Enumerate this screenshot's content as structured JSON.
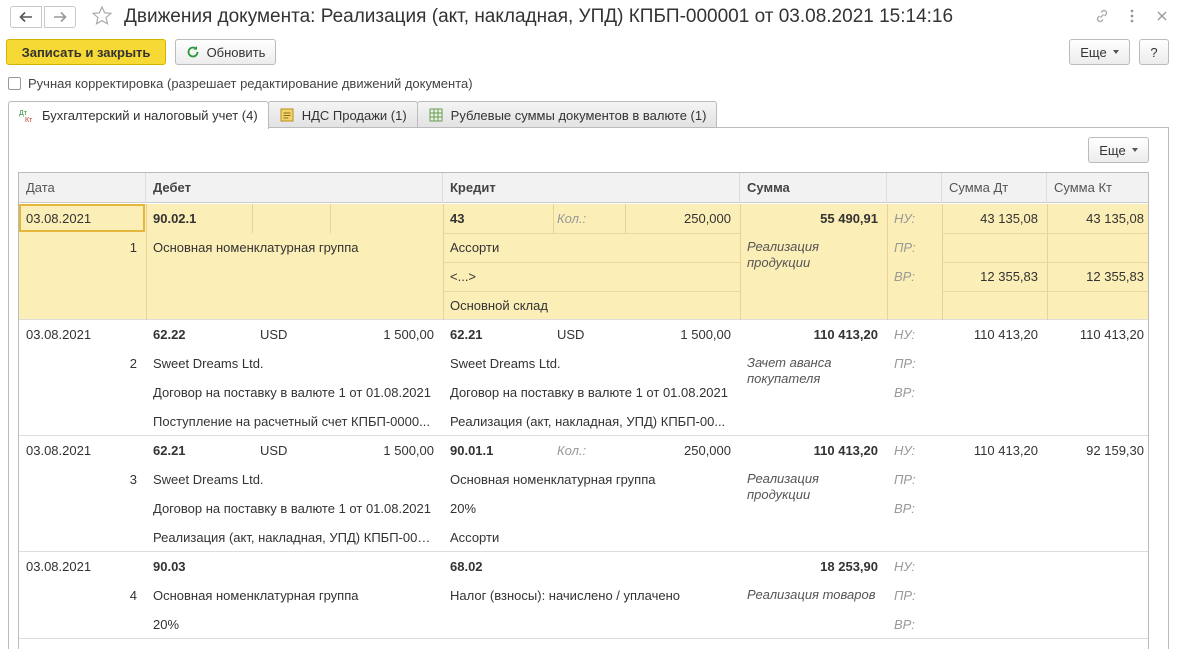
{
  "window": {
    "title": "Движения документа: Реализация (акт, накладная, УПД) КПБП-000001 от 03.08.2021 15:14:16"
  },
  "toolbar": {
    "save_close": "Записать и закрыть",
    "refresh": "Обновить",
    "more": "Еще",
    "help": "?"
  },
  "manual_edit": {
    "label": "Ручная корректировка (разрешает редактирование движений документа)",
    "checked": false
  },
  "tabs": [
    {
      "label": "Бухгалтерский и налоговый учет (4)",
      "icon": "dt-kt-icon",
      "active": true
    },
    {
      "label": "НДС Продажи (1)",
      "icon": "journal-icon",
      "active": false
    },
    {
      "label": "Рублевые суммы документов в валюте (1)",
      "icon": "table-icon",
      "active": false
    }
  ],
  "grid_more": "Еще",
  "columns": {
    "date": "Дата",
    "debit": "Дебет",
    "credit": "Кредит",
    "sum": "Сумма",
    "sum_dt": "Сумма Дт",
    "sum_kt": "Сумма Кт"
  },
  "records": [
    {
      "date": "03.08.2021",
      "num": "1",
      "dt_account": "90.02.1",
      "dt_qty_label": "",
      "dt_qty": "",
      "dt_sub": [
        "Основная номенклатурная группа",
        "",
        ""
      ],
      "kt_account": "43",
      "kt_qty_label": "Кол.:",
      "kt_qty": "250,000",
      "kt_sub": [
        "Ассорти",
        "<...>",
        "Основной склад"
      ],
      "sum": "55 490,91",
      "description": "Реализация продукции",
      "nu": "НУ:",
      "pr": "ПР:",
      "vr": "ВР:",
      "nu_dt": "43 135,08",
      "nu_kt": "43 135,08",
      "pr_dt": "",
      "pr_kt": "",
      "vr_dt": "12 355,83",
      "vr_kt": "12 355,83"
    },
    {
      "date": "03.08.2021",
      "num": "2",
      "dt_account": "62.22",
      "dt_qty_label": "USD",
      "dt_qty": "1 500,00",
      "dt_sub": [
        "Sweet Dreams Ltd.",
        "Договор на поставку в валюте 1 от 01.08.2021",
        "Поступление на расчетный счет КПБП-0000..."
      ],
      "kt_account": "62.21",
      "kt_qty_label": "USD",
      "kt_qty": "1 500,00",
      "kt_sub": [
        "Sweet Dreams Ltd.",
        "Договор на поставку в валюте 1 от 01.08.2021",
        "Реализация (акт, накладная, УПД) КПБП-00..."
      ],
      "sum": "110 413,20",
      "description": "Зачет аванса покупателя",
      "nu": "НУ:",
      "pr": "ПР:",
      "vr": "ВР:",
      "nu_dt": "110 413,20",
      "nu_kt": "110 413,20",
      "pr_dt": "",
      "pr_kt": "",
      "vr_dt": "",
      "vr_kt": ""
    },
    {
      "date": "03.08.2021",
      "num": "3",
      "dt_account": "62.21",
      "dt_qty_label": "USD",
      "dt_qty": "1 500,00",
      "dt_sub": [
        "Sweet Dreams Ltd.",
        "Договор на поставку в валюте 1 от 01.08.2021",
        "Реализация (акт, накладная, УПД) КПБП-000..."
      ],
      "kt_account": "90.01.1",
      "kt_qty_label": "Кол.:",
      "kt_qty": "250,000",
      "kt_sub": [
        "Основная номенклатурная группа",
        "20%",
        "Ассорти"
      ],
      "sum": "110 413,20",
      "description": "Реализация продукции",
      "nu": "НУ:",
      "pr": "ПР:",
      "vr": "ВР:",
      "nu_dt": "110 413,20",
      "nu_kt": "92 159,30",
      "pr_dt": "",
      "pr_kt": "",
      "vr_dt": "",
      "vr_kt": ""
    },
    {
      "date": "03.08.2021",
      "num": "4",
      "dt_account": "90.03",
      "dt_qty_label": "",
      "dt_qty": "",
      "dt_sub": [
        "Основная номенклатурная группа",
        "20%",
        ""
      ],
      "kt_account": "68.02",
      "kt_qty_label": "",
      "kt_qty": "",
      "kt_sub": [
        "Налог (взносы): начислено / уплачено",
        "",
        ""
      ],
      "sum": "18 253,90",
      "description": "Реализация товаров",
      "nu": "НУ:",
      "pr": "ПР:",
      "vr": "ВР:",
      "nu_dt": "",
      "nu_kt": "",
      "pr_dt": "",
      "pr_kt": "",
      "vr_dt": "",
      "vr_kt": ""
    }
  ]
}
